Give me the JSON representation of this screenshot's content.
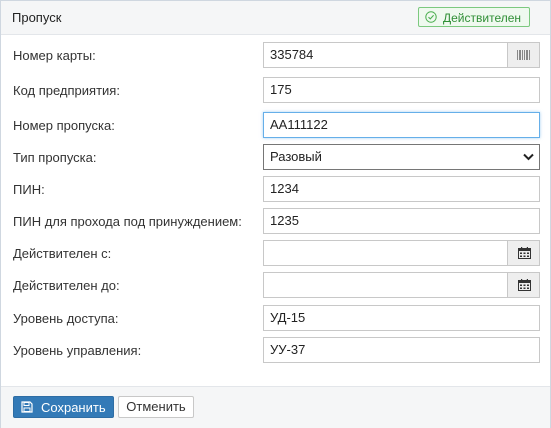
{
  "panel": {
    "title": "Пропуск",
    "status": "Действителен",
    "status_color": "#2f8f35"
  },
  "form": {
    "card_number": {
      "label": "Номер карты:",
      "value": "335784",
      "button_icon": "barcode-icon"
    },
    "company_code": {
      "label": "Код предприятия:",
      "value": "175"
    },
    "pass_number": {
      "label": "Номер пропуска:",
      "value": "АА111122"
    },
    "pass_type": {
      "label": "Тип пропуска:",
      "value": "Разовый"
    },
    "pin": {
      "label": "ПИН:",
      "value": "1234"
    },
    "duress_pin": {
      "label": "ПИН для прохода под принуждением:",
      "value": "1235"
    },
    "valid_from": {
      "label": "Действителен с:",
      "value": "",
      "button_icon": "calendar-icon"
    },
    "valid_to": {
      "label": "Действителен до:",
      "value": "",
      "button_icon": "calendar-icon"
    },
    "access_level": {
      "label": "Уровень доступа:",
      "value": "УД-15"
    },
    "control_level": {
      "label": "Уровень управления:",
      "value": "УУ-37"
    }
  },
  "footer": {
    "save_label": "Сохранить",
    "cancel_label": "Отменить",
    "save_color": "#337ab7"
  }
}
